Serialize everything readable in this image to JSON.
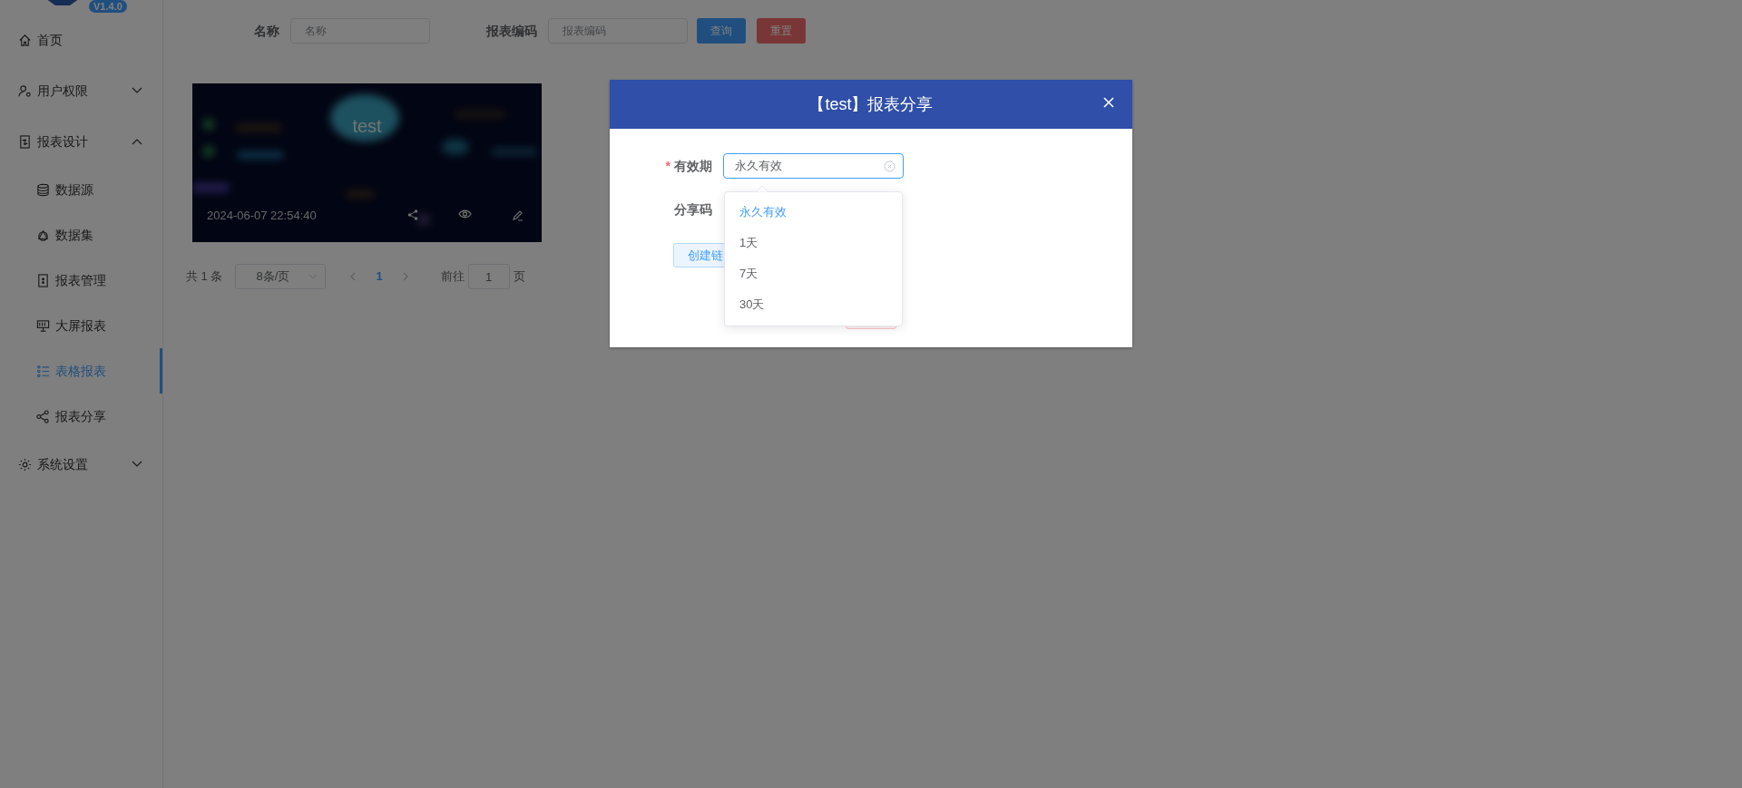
{
  "sidebar": {
    "version": "V1.4.0",
    "items": [
      {
        "label": "首页",
        "selected": false
      },
      {
        "label": "用户权限",
        "selected": false,
        "expanded": false
      },
      {
        "label": "报表设计",
        "selected": false,
        "expanded": true,
        "children": [
          {
            "label": "数据源",
            "selected": false
          },
          {
            "label": "数据集",
            "selected": false
          },
          {
            "label": "报表管理",
            "selected": false
          },
          {
            "label": "大屏报表",
            "selected": false
          },
          {
            "label": "表格报表",
            "selected": true
          },
          {
            "label": "报表分享",
            "selected": false
          }
        ]
      },
      {
        "label": "系统设置",
        "selected": false,
        "expanded": false
      }
    ]
  },
  "search": {
    "fields": [
      {
        "label": "名称",
        "placeholder": "名称"
      },
      {
        "label": "报表编码",
        "placeholder": "报表编码"
      }
    ],
    "buttons": [
      {
        "label": "查询",
        "kind": "primary"
      },
      {
        "label": "重置",
        "kind": "danger"
      }
    ]
  },
  "cards": [
    {
      "title": "test",
      "time": "2024-06-07 22:54:40"
    }
  ],
  "pagination": {
    "total": "共 1 条",
    "page_size": "8条/页",
    "pages": [
      {
        "label": "1",
        "selected": true
      }
    ],
    "goto_label": "前往",
    "goto_value": "1",
    "goto_suffix": "页"
  },
  "dialog": {
    "title": "【test】报表分享",
    "fields": [
      {
        "label": "有效期",
        "required_mark": "*",
        "value": "永久有效"
      },
      {
        "label": "分享码"
      }
    ],
    "create_button": "创建链",
    "dropdown": [
      {
        "label": "永久有效",
        "selected": true
      },
      {
        "label": "1天",
        "selected": false
      },
      {
        "label": "7天",
        "selected": false
      },
      {
        "label": "30天",
        "selected": false
      }
    ]
  }
}
